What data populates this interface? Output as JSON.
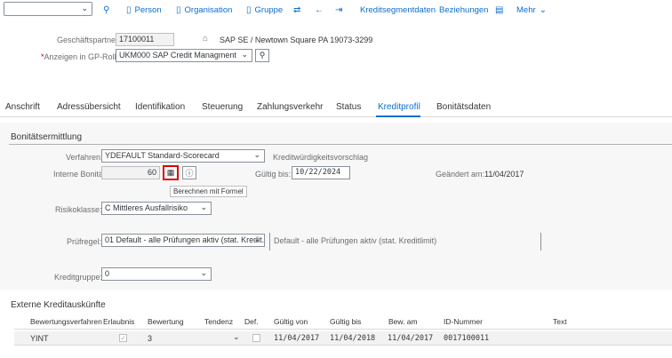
{
  "toolbar": {
    "items": [
      {
        "label": "",
        "icon": "hierarchy-icon"
      },
      {
        "label": "Person",
        "icon": "document-icon"
      },
      {
        "label": "Organisation",
        "icon": "document-icon"
      },
      {
        "label": "Gruppe",
        "icon": "document-icon"
      },
      {
        "label": "",
        "icon": "switch-icon"
      },
      {
        "label": "",
        "icon": "back-arrow-icon"
      },
      {
        "label": "",
        "icon": "forward-arrow-icon"
      },
      {
        "label": "Kreditsegmentdaten",
        "icon": ""
      },
      {
        "label": "Beziehungen",
        "icon": ""
      },
      {
        "label": "",
        "icon": "display-icon"
      },
      {
        "label": "Mehr",
        "icon": "chevron-down-icon"
      }
    ]
  },
  "header": {
    "partner_label": "Geschäftspartner:",
    "partner_value": "17100011",
    "partner_desc": "SAP SE / Newtown Square PA 19073-3299",
    "role_required": "*",
    "role_label": "Anzeigen in GP-Rolle",
    "role_value": "UKM000 SAP Credit Managment"
  },
  "tabs": [
    "Anschrift",
    "Adressübersicht",
    "Identifikation",
    "Steuerung",
    "Zahlungsverkehr",
    "Status",
    "Kreditprofil",
    "Bonitätsdaten"
  ],
  "active_tab": "Kreditprofil",
  "bonitaet": {
    "title": "Bonitätsermittlung",
    "verfahren_label": "Verfahren:",
    "verfahren_value": "YDEFAULT Standard-Scorecard",
    "kwv_label": "Kreditwürdigkeitsvorschlag",
    "intern_label": "Interne Bonität",
    "intern_value": "60",
    "gueltig_label": "Gültig bis:",
    "gueltig_value": "10/22/2024",
    "geaendert_label": "Geändert am:",
    "geaendert_value": "11/04/2017",
    "tooltip": "Berechnen mit Formel",
    "risiko_label": "Risikoklasse:",
    "risiko_value": "C Mittleres Ausfallrisiko",
    "pruef_label": "Prüfregel:",
    "pruef_value": "01 Default - alle Prüfungen aktiv (stat. Kredit...",
    "pruef_desc": "Default - alle Prüfungen aktiv (stat. Kreditlimit)",
    "kgruppe_label": "Kreditgruppe:",
    "kgruppe_value": "0"
  },
  "extern": {
    "title": "Externe Kreditauskünfte",
    "columns": [
      "Bewertungsverfahren",
      "Erlaubnis",
      "Bewertung",
      "Tendenz",
      "Def.",
      "Gültig von",
      "Gültig bis",
      "Bew. am",
      "ID-Nummer",
      "Text"
    ],
    "rows": [
      {
        "verfahren": "YINT",
        "erlaubnis": "✓",
        "bewertung": "3",
        "tendenz": "",
        "def": "",
        "gueltig_von": "11/04/2017",
        "gueltig_bis": "11/04/2018",
        "bew_am": "11/04/2017",
        "id": "0017100011",
        "text": ""
      }
    ]
  },
  "colors": {
    "accent": "#0a6ed1",
    "highlight_border": "#e00000"
  }
}
